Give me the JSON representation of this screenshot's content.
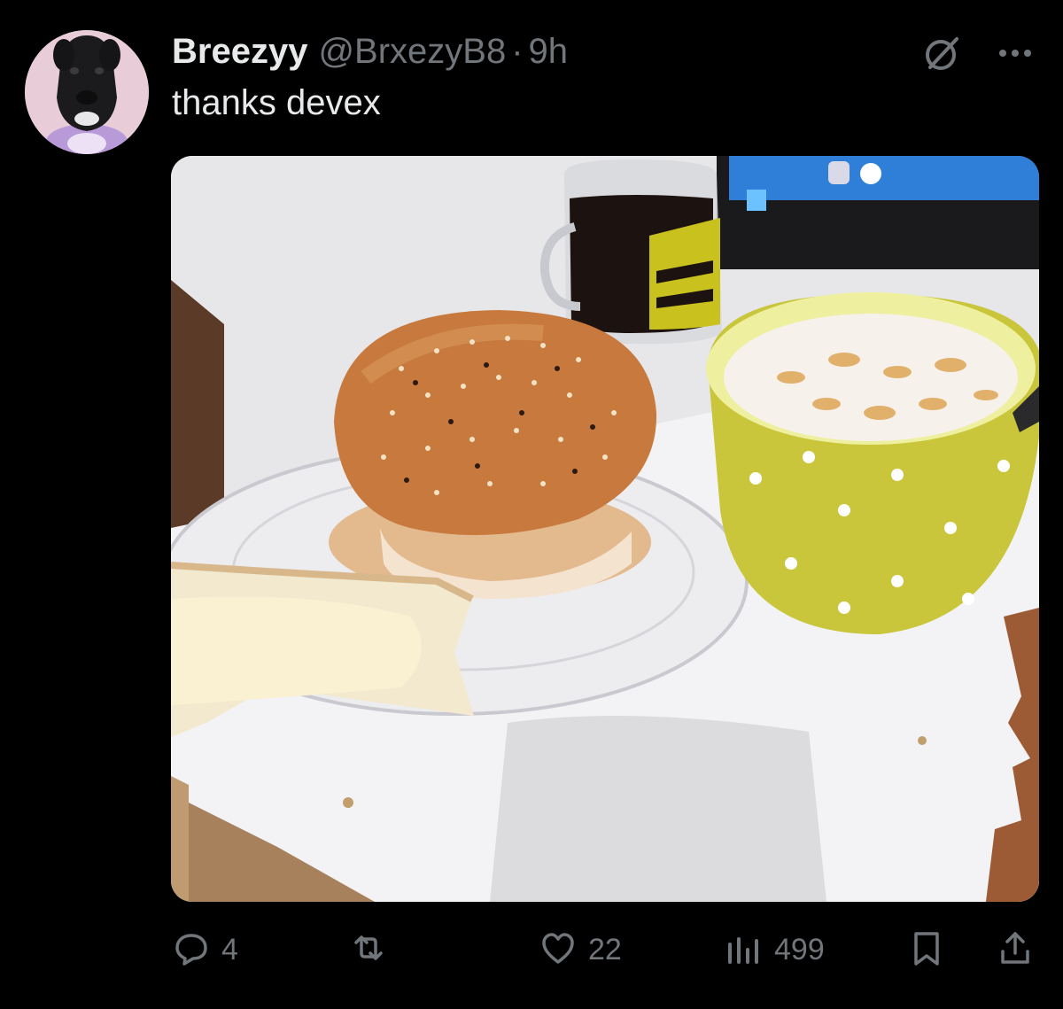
{
  "tweet": {
    "display_name": "Breezyy",
    "handle": "@BrxezyB8",
    "separator": "·",
    "time_ago": "9h",
    "text": "thanks devex",
    "image_description_icon": "photo"
  },
  "actions": {
    "replies": "4",
    "retweets": "",
    "likes": "22",
    "views": "499"
  },
  "icons": {
    "header": [
      "grok-icon",
      "more-icon"
    ],
    "actions": [
      "reply-icon",
      "retweet-icon",
      "like-icon",
      "views-icon",
      "bookmark-icon",
      "share-icon"
    ]
  },
  "colors": {
    "background": "#000000",
    "primary_text": "#e7e9ea",
    "secondary_text": "#71767b"
  }
}
